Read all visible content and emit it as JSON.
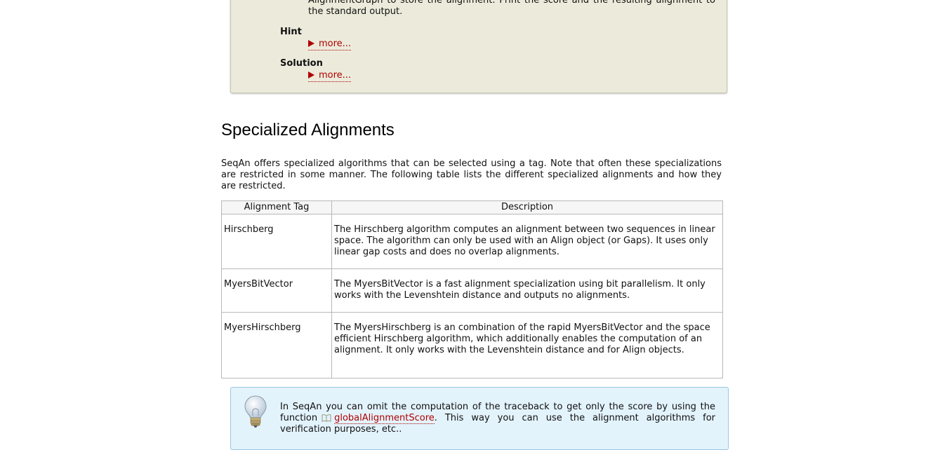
{
  "assignment": {
    "text": "AlignmentGraph to store the alignment. Print the score and the resulting alignment to the standard output.",
    "hint_label": "Hint",
    "hint_link": "more...",
    "solution_label": "Solution",
    "solution_link": "more..."
  },
  "section": {
    "title": "Specialized Alignments",
    "intro": "SeqAn offers specialized algorithms that can be selected using a tag. Note that often these specializations are restricted in some manner. The following table lists the different specialized alignments and how they are restricted."
  },
  "table": {
    "headers": [
      "Alignment Tag",
      "Description"
    ],
    "rows": [
      {
        "tag": "Hirschberg",
        "description": "The Hirschberg algorithm computes an alignment between two sequences in linear space. The algorithm can only be used with an Align object (or Gaps). It uses only linear gap costs and does no overlap alignments."
      },
      {
        "tag": "MyersBitVector",
        "description": "The MyersBitVector is a fast alignment specialization using bit parallelism. It only works with the Levenshtein distance and outputs no alignments."
      },
      {
        "tag": "MyersHirschberg",
        "description": "The MyersHirschberg is an combination of the rapid MyersBitVector and the space efficient Hirschberg algorithm, which additionally enables the computation of an alignment. It only works with the Levenshtein distance and for Align objects."
      }
    ]
  },
  "note": {
    "text_before": "In SeqAn you can omit the computation of the traceback to get only the score by using the function",
    "link": "globalAlignmentScore",
    "text_after": ". This way you can use the alignment algorithms for verification purposes, etc.."
  },
  "icons": {
    "note": "lightbulb-icon",
    "link": "book-icon",
    "expand": "triangle-right-icon"
  },
  "colors": {
    "link": "#b00000",
    "assignment_bg": "#ecebdb",
    "note_bg": "#e3f3fc"
  }
}
